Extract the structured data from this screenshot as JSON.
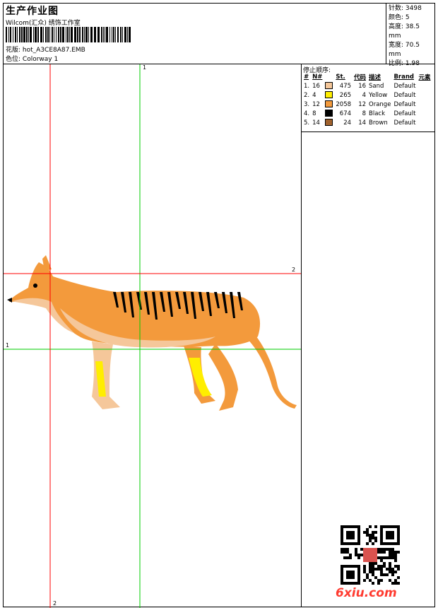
{
  "header": {
    "title": "生产作业图",
    "company": "Wilcom(汇众) 绣饰工作室",
    "design_label": "花版:",
    "design_value": "hot_A3CE8A87.EMB",
    "colorway_label": "色位:",
    "colorway_value": "Colorway 1"
  },
  "stats": [
    {
      "label": "针数:",
      "value": "3498"
    },
    {
      "label": "颜色:",
      "value": "5"
    },
    {
      "label": "高度:",
      "value": "38.5 mm"
    },
    {
      "label": "宽度:",
      "value": "70.5 mm"
    },
    {
      "label": "比例:",
      "value": "1.98"
    }
  ],
  "sequence": {
    "title": "停止顺序:",
    "headers": [
      "#",
      "N#",
      "St.",
      "代码",
      "描述",
      "Brand",
      "元素"
    ],
    "rows": [
      {
        "idx": "1.",
        "n": "16",
        "color": "#f5c79a",
        "st": "475",
        "code": "16",
        "desc": "Sand",
        "brand": "Default"
      },
      {
        "idx": "2.",
        "n": "4",
        "color": "#ffee00",
        "st": "265",
        "code": "4",
        "desc": "Yellow",
        "brand": "Default"
      },
      {
        "idx": "3.",
        "n": "12",
        "color": "#f39a3c",
        "st": "2058",
        "code": "12",
        "desc": "Orange",
        "brand": "Default"
      },
      {
        "idx": "4.",
        "n": "8",
        "color": "#000000",
        "st": "674",
        "code": "8",
        "desc": "Black",
        "brand": "Default"
      },
      {
        "idx": "5.",
        "n": "14",
        "color": "#a0622d",
        "st": "24",
        "code": "14",
        "desc": "Brown",
        "brand": "Default"
      }
    ]
  },
  "axes": {
    "green_v": "1",
    "green_h": "1",
    "red_h": "2",
    "red_v": "2"
  },
  "watermark": "6xiu.com",
  "colors": {
    "red_axis": "#ff0000",
    "green_axis": "#00cc00",
    "sand": "#f5c79a",
    "orange": "#f39a3c",
    "yellow": "#ffee00",
    "black": "#000000"
  }
}
